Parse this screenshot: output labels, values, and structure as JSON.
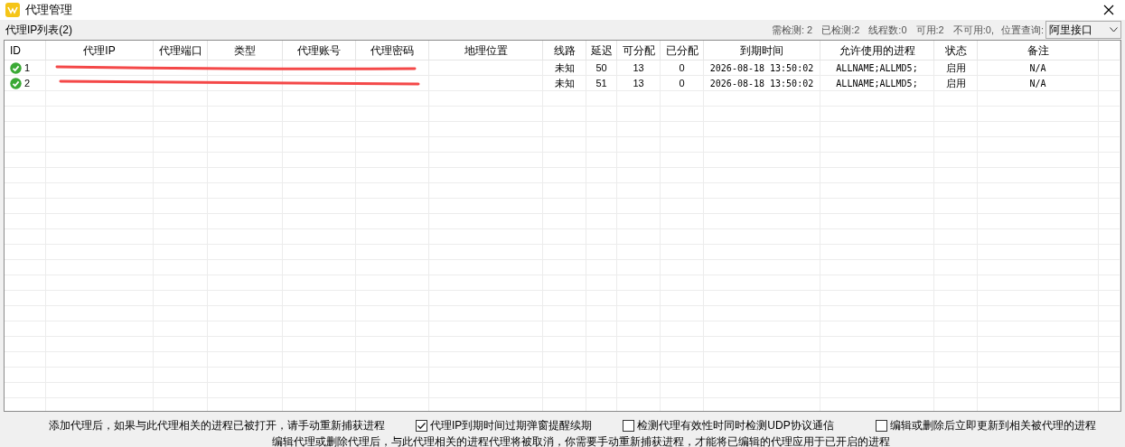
{
  "window": {
    "title": "代理管理"
  },
  "list_title": "代理IP列表(2)",
  "stats": [
    "需检测: 2",
    "已检测:2",
    "线程数:0",
    "可用:2",
    "不可用:0,"
  ],
  "location_query": {
    "label": "位置查询:",
    "value": "阿里接口"
  },
  "table": {
    "columns": [
      "ID",
      "代理IP",
      "代理端口",
      "类型",
      "代理账号",
      "代理密码",
      "地理位置",
      "线路",
      "延迟",
      "可分配",
      "已分配",
      "到期时间",
      "允许使用的进程",
      "状态",
      "备注"
    ],
    "rows": [
      {
        "status_ok": true,
        "redacted": true,
        "cells": [
          "1",
          "",
          "",
          "",
          "",
          "",
          "",
          "未知",
          "50",
          "13",
          "0",
          "2026-08-18 13:50:02",
          "ALLNAME;ALLMD5;",
          "启用",
          "N/A"
        ]
      },
      {
        "status_ok": true,
        "redacted": true,
        "cells": [
          "2",
          "",
          "",
          "",
          "",
          "",
          "",
          "未知",
          "51",
          "13",
          "0",
          "2026-08-18 13:50:02",
          "ALLNAME;ALLMD5;",
          "启用",
          "N/A"
        ]
      }
    ]
  },
  "notice": "添加代理后，如果与此代理相关的进程已被打开，请手动重新捕获进程",
  "options": [
    {
      "label": "代理IP到期时间过期弹窗提醒续期",
      "checked": true
    },
    {
      "label": "检测代理有效性时同时检测UDP协议通信",
      "checked": false
    },
    {
      "label": "编辑或删除后立即更新到相关被代理的进程",
      "checked": false
    }
  ],
  "footer": "编辑代理或删除代理后，与此代理相关的进程代理将被取消，你需要手动重新捕获进程，才能将已编辑的代理应用于已开启的进程"
}
